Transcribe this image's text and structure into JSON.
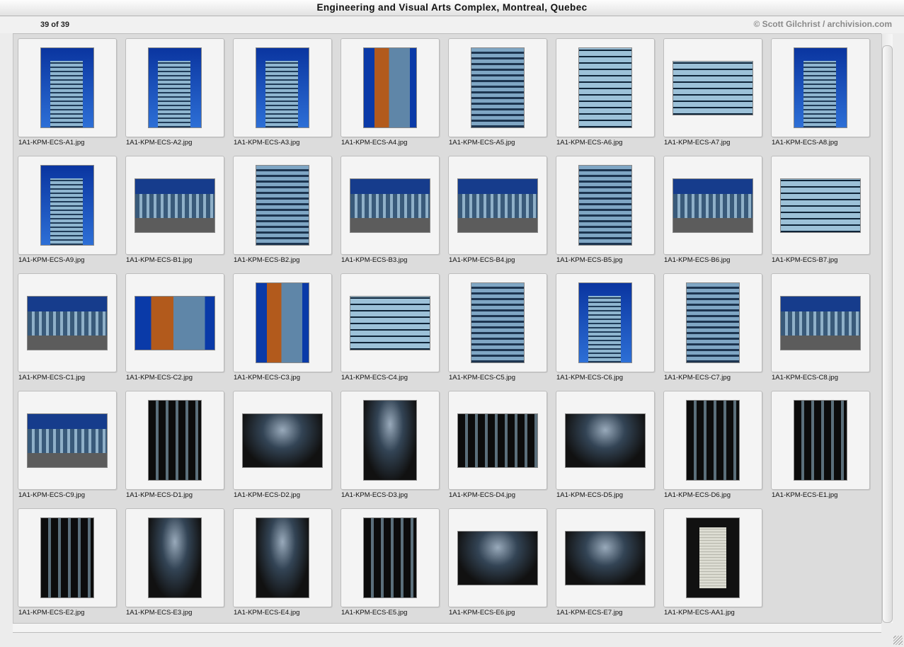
{
  "window": {
    "title": "Engineering and Visual Arts Complex, Montreal, Quebec"
  },
  "header": {
    "counter": "39 of 39",
    "copyright": "© Scott Gilchrist / archivision.com"
  },
  "thumbnails": [
    {
      "name": "1A1-KPM-ECS-A1.jpg",
      "orientation": "portrait",
      "style": "s-sky-tower"
    },
    {
      "name": "1A1-KPM-ECS-A2.jpg",
      "orientation": "portrait",
      "style": "s-sky-tower"
    },
    {
      "name": "1A1-KPM-ECS-A3.jpg",
      "orientation": "portrait",
      "style": "s-sky-tower"
    },
    {
      "name": "1A1-KPM-ECS-A4.jpg",
      "orientation": "portrait",
      "style": "s-orange"
    },
    {
      "name": "1A1-KPM-ECS-A5.jpg",
      "orientation": "portrait",
      "style": "s-glass"
    },
    {
      "name": "1A1-KPM-ECS-A6.jpg",
      "orientation": "portrait",
      "style": "s-glass2"
    },
    {
      "name": "1A1-KPM-ECS-A7.jpg",
      "orientation": "landscape",
      "style": "s-glass2"
    },
    {
      "name": "1A1-KPM-ECS-A8.jpg",
      "orientation": "portrait",
      "style": "s-sky-tower"
    },
    {
      "name": "1A1-KPM-ECS-A9.jpg",
      "orientation": "portrait",
      "style": "s-sky-tower"
    },
    {
      "name": "1A1-KPM-ECS-B1.jpg",
      "orientation": "landscape",
      "style": "s-street"
    },
    {
      "name": "1A1-KPM-ECS-B2.jpg",
      "orientation": "portrait",
      "style": "s-glass"
    },
    {
      "name": "1A1-KPM-ECS-B3.jpg",
      "orientation": "landscape",
      "style": "s-street"
    },
    {
      "name": "1A1-KPM-ECS-B4.jpg",
      "orientation": "landscape",
      "style": "s-street"
    },
    {
      "name": "1A1-KPM-ECS-B5.jpg",
      "orientation": "portrait",
      "style": "s-glass"
    },
    {
      "name": "1A1-KPM-ECS-B6.jpg",
      "orientation": "landscape",
      "style": "s-street"
    },
    {
      "name": "1A1-KPM-ECS-B7.jpg",
      "orientation": "landscape",
      "style": "s-glass2"
    },
    {
      "name": "1A1-KPM-ECS-C1.jpg",
      "orientation": "landscape",
      "style": "s-street"
    },
    {
      "name": "1A1-KPM-ECS-C2.jpg",
      "orientation": "landscape",
      "style": "s-orange"
    },
    {
      "name": "1A1-KPM-ECS-C3.jpg",
      "orientation": "portrait",
      "style": "s-orange"
    },
    {
      "name": "1A1-KPM-ECS-C4.jpg",
      "orientation": "landscape",
      "style": "s-glass2"
    },
    {
      "name": "1A1-KPM-ECS-C5.jpg",
      "orientation": "portrait",
      "style": "s-glass"
    },
    {
      "name": "1A1-KPM-ECS-C6.jpg",
      "orientation": "portrait",
      "style": "s-sky-tower"
    },
    {
      "name": "1A1-KPM-ECS-C7.jpg",
      "orientation": "portrait",
      "style": "s-glass"
    },
    {
      "name": "1A1-KPM-ECS-C8.jpg",
      "orientation": "landscape",
      "style": "s-street"
    },
    {
      "name": "1A1-KPM-ECS-C9.jpg",
      "orientation": "landscape",
      "style": "s-street"
    },
    {
      "name": "1A1-KPM-ECS-D1.jpg",
      "orientation": "portrait",
      "style": "s-dark2"
    },
    {
      "name": "1A1-KPM-ECS-D2.jpg",
      "orientation": "landscape",
      "style": "s-dark"
    },
    {
      "name": "1A1-KPM-ECS-D3.jpg",
      "orientation": "portrait",
      "style": "s-dark"
    },
    {
      "name": "1A1-KPM-ECS-D4.jpg",
      "orientation": "landscape",
      "style": "s-dark2"
    },
    {
      "name": "1A1-KPM-ECS-D5.jpg",
      "orientation": "landscape",
      "style": "s-dark"
    },
    {
      "name": "1A1-KPM-ECS-D6.jpg",
      "orientation": "portrait",
      "style": "s-dark2"
    },
    {
      "name": "1A1-KPM-ECS-E1.jpg",
      "orientation": "portrait",
      "style": "s-dark2"
    },
    {
      "name": "1A1-KPM-ECS-E2.jpg",
      "orientation": "portrait",
      "style": "s-dark2"
    },
    {
      "name": "1A1-KPM-ECS-E3.jpg",
      "orientation": "portrait",
      "style": "s-dark"
    },
    {
      "name": "1A1-KPM-ECS-E4.jpg",
      "orientation": "portrait",
      "style": "s-dark"
    },
    {
      "name": "1A1-KPM-ECS-E5.jpg",
      "orientation": "portrait",
      "style": "s-dark2"
    },
    {
      "name": "1A1-KPM-ECS-E6.jpg",
      "orientation": "landscape",
      "style": "s-dark"
    },
    {
      "name": "1A1-KPM-ECS-E7.jpg",
      "orientation": "landscape",
      "style": "s-dark"
    },
    {
      "name": "1A1-KPM-ECS-AA1.jpg",
      "orientation": "portrait",
      "style": "s-doc"
    }
  ]
}
